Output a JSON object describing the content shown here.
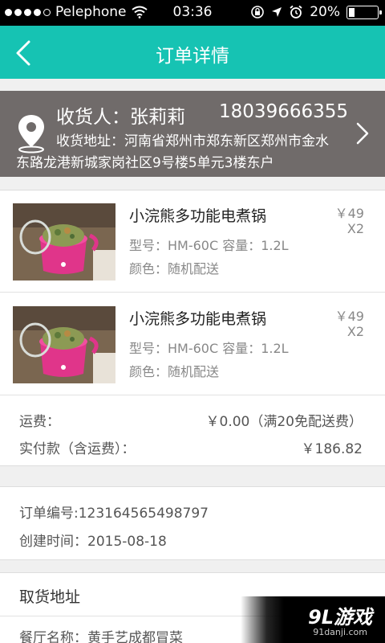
{
  "status_bar": {
    "carrier": "Pelephone",
    "time": "03:36",
    "battery": "20%",
    "battery_level": 0.2,
    "signal_bars": 4,
    "icons": [
      "signal-dots-icon",
      "wifi-icon",
      "rotation-lock-icon",
      "location-arrow-icon",
      "alarm-icon",
      "battery-icon"
    ]
  },
  "nav": {
    "title": "订单详情",
    "back_icon": "chevron-left-icon"
  },
  "colors": {
    "accent": "#16c3b3",
    "address_bg": "#706b6a"
  },
  "address": {
    "recipient": "收货人：张莉莉",
    "phone": "18039666355",
    "line1": "收货地址：河南省郑州市郑东新区郑州市金水",
    "line2": "东路龙港新城家岗社区9号楼5单元3楼东户",
    "icon": "location-pin-icon"
  },
  "items": [
    {
      "name": "小浣熊多功能电煮锅",
      "price": "￥49",
      "qty": "X2",
      "spec": "型号：HM-60C 容量：1.2L",
      "color": "颜色：随机配送"
    },
    {
      "name": "小浣熊多功能电煮锅",
      "price": "￥49",
      "qty": "X2",
      "spec": "型号：HM-60C 容量：1.2L",
      "color": "颜色：随机配送"
    }
  ],
  "summary": {
    "shipping_label": "运费：",
    "shipping_value": "￥0.00（满20免配送费）",
    "paid_label": "实付款（含运费）：",
    "paid_value": "￥186.82"
  },
  "order": {
    "number": "订单编号:123164565498797",
    "created": "创建时间：2015-08-18"
  },
  "pickup": {
    "title": "取货地址",
    "restaurant": "餐厅名称：黄手艺成都冒菜"
  },
  "watermark": {
    "logo": "9L游戏",
    "site": "91danji.com"
  }
}
